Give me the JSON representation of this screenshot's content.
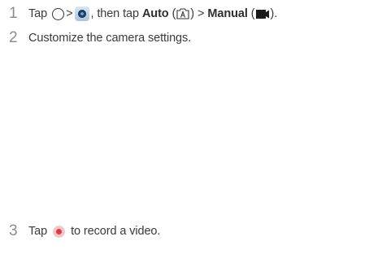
{
  "steps": [
    {
      "number": "1",
      "parts": {
        "tap": "Tap",
        "gt1": ">",
        "then_tap": ", then tap",
        "auto": "Auto",
        "open_paren1": "(",
        "close_paren1": ")",
        "gt2": ">",
        "manual": "Manual",
        "open_paren2": "(",
        "close_paren2": ")."
      },
      "icons": [
        "home-icon",
        "camera-app-icon",
        "auto-mode-icon",
        "manual-video-icon"
      ]
    },
    {
      "number": "2",
      "text": "Customize the camera settings."
    },
    {
      "number": "3",
      "parts": {
        "tap": "Tap",
        "rest": "to record a video."
      },
      "icons": [
        "record-icon"
      ]
    }
  ],
  "colors": {
    "text": "#3a3a3a",
    "step_number": "#8c8c8c",
    "record_red": "#e03a45",
    "camera_blue": "#1d3f6e"
  }
}
